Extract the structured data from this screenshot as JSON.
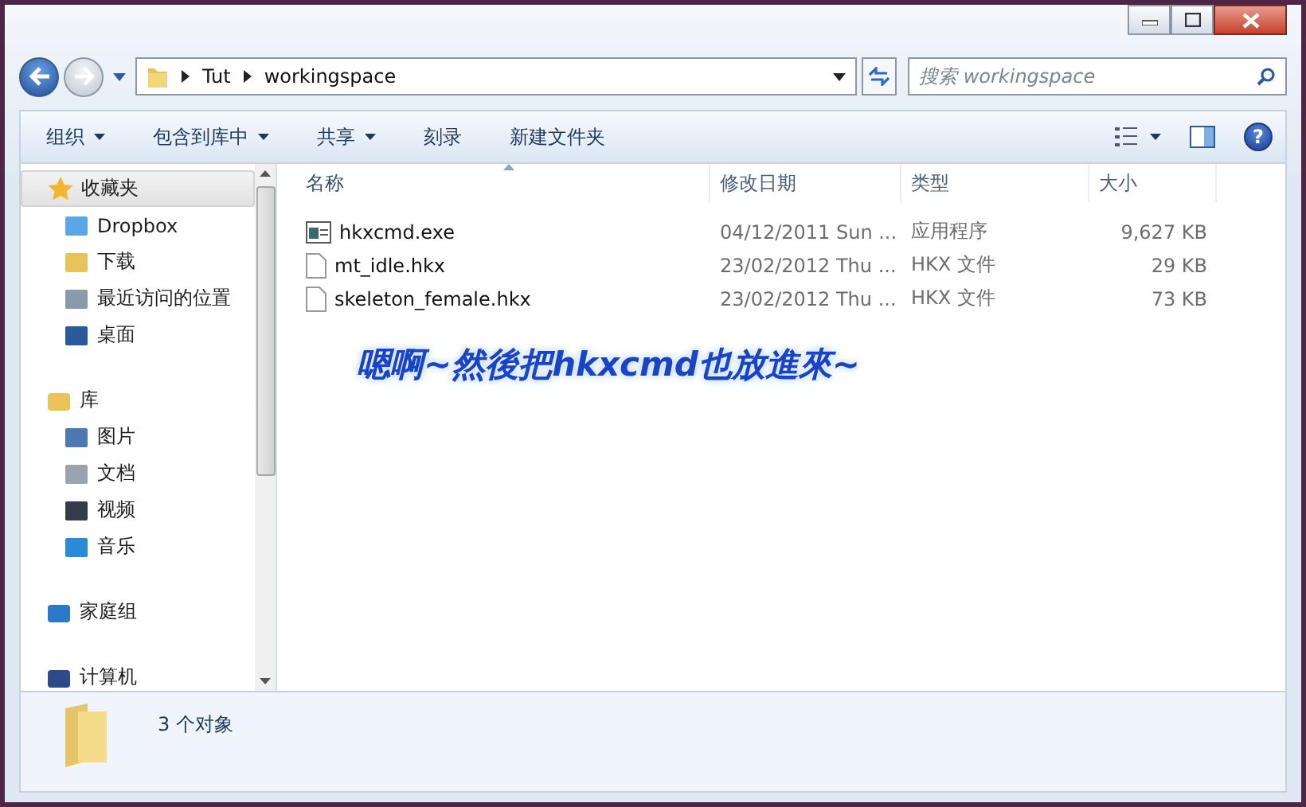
{
  "address": {
    "breadcrumbs": [
      "Tut",
      "workingspace"
    ]
  },
  "search": {
    "placeholder": "搜索 workingspace"
  },
  "toolbar": {
    "menus": [
      {
        "label": "组织",
        "dropdown": true
      },
      {
        "label": "包含到库中",
        "dropdown": true
      },
      {
        "label": "共享",
        "dropdown": true
      },
      {
        "label": "刻录",
        "dropdown": false
      },
      {
        "label": "新建文件夹",
        "dropdown": false
      }
    ],
    "help": "?"
  },
  "nav": [
    {
      "label": "收藏夹",
      "selected": true,
      "children": [
        {
          "label": "Dropbox",
          "selected": false
        },
        {
          "label": "下载",
          "selected": false
        },
        {
          "label": "最近访问的位置",
          "selected": false
        },
        {
          "label": "桌面",
          "selected": false
        }
      ]
    },
    {
      "label": "库",
      "selected": false,
      "children": [
        {
          "label": "图片",
          "selected": false
        },
        {
          "label": "文档",
          "selected": false
        },
        {
          "label": "视频",
          "selected": false
        },
        {
          "label": "音乐",
          "selected": false
        }
      ]
    },
    {
      "label": "家庭组",
      "selected": false
    },
    {
      "label": "计算机",
      "selected": false
    }
  ],
  "columns": [
    {
      "label": "名称",
      "sorted": true
    },
    {
      "label": "修改日期",
      "sorted": false
    },
    {
      "label": "类型",
      "sorted": false
    },
    {
      "label": "大小",
      "sorted": false
    }
  ],
  "files": [
    {
      "name": "hkxcmd.exe",
      "kind": "exe",
      "date": "04/12/2011 Sun ...",
      "type": "应用程序",
      "size": "9,627 KB"
    },
    {
      "name": "mt_idle.hkx",
      "kind": "file",
      "date": "23/02/2012 Thu ...",
      "type": "HKX 文件",
      "size": "29 KB"
    },
    {
      "name": "skeleton_female.hkx",
      "kind": "file",
      "date": "23/02/2012 Thu ...",
      "type": "HKX 文件",
      "size": "73 KB"
    }
  ],
  "caption": "嗯啊~然後把hkxcmd也放進來~",
  "status_bar": {
    "count": "3 个对象"
  }
}
